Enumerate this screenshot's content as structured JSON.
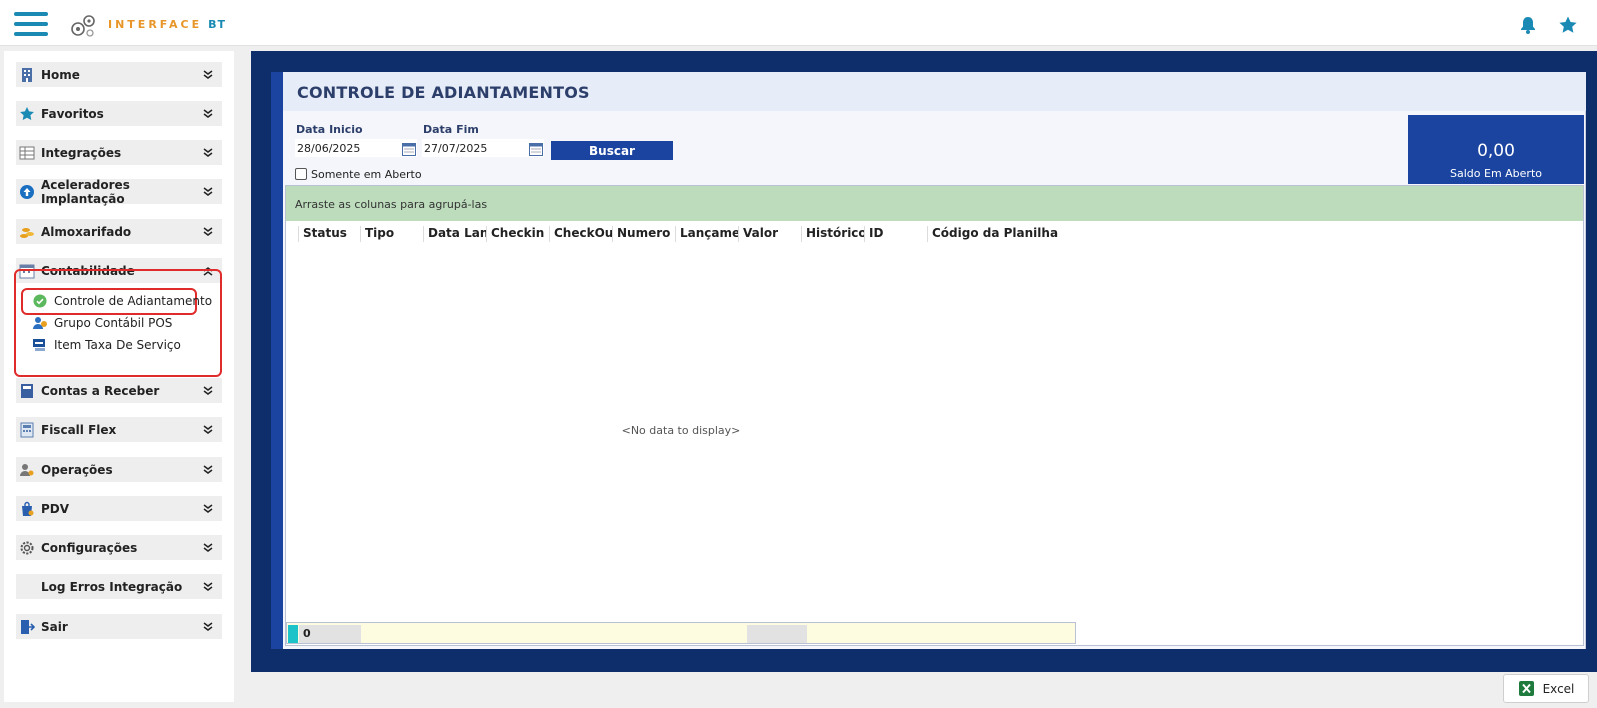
{
  "header": {
    "logo_text": "INTERFACE",
    "logo_suffix": "BT"
  },
  "sidebar": {
    "items": [
      {
        "label": "Home",
        "icon": "building-icon"
      },
      {
        "label": "Favoritos",
        "icon": "star-icon"
      },
      {
        "label": "Integrações",
        "icon": "table-icon"
      },
      {
        "label": "Aceleradores Implantação",
        "icon": "upload-circle-icon"
      },
      {
        "label": "Almoxarifado",
        "icon": "coins-icon"
      },
      {
        "label": "Contabilidade",
        "icon": "calendar-icon",
        "expanded": true
      },
      {
        "label": "Contas a Receber",
        "icon": "book-icon"
      },
      {
        "label": "Fiscall Flex",
        "icon": "calculator-icon"
      },
      {
        "label": "Operações",
        "icon": "user-gear-icon"
      },
      {
        "label": "PDV",
        "icon": "shopping-bag-icon"
      },
      {
        "label": "Configurações",
        "icon": "gear-icon"
      },
      {
        "label": "Log Erros Integração",
        "icon": "log-icon"
      },
      {
        "label": "Sair",
        "icon": "exit-door-icon"
      }
    ],
    "submenu": [
      {
        "label": "Controle de Adiantamento",
        "icon": "check-circle-icon"
      },
      {
        "label": "Grupo Contábil POS",
        "icon": "users-icon"
      },
      {
        "label": "Item Taxa De Serviço",
        "icon": "service-tag-icon"
      }
    ]
  },
  "page": {
    "title": "CONTROLE DE ADIANTAMENTOS"
  },
  "filters": {
    "data_inicio_label": "Data Inicio",
    "data_inicio_value": "28/06/2025",
    "data_fim_label": "Data Fim",
    "data_fim_value": "27/07/2025",
    "buscar_label": "Buscar",
    "somente_aberto_label": "Somente em Aberto"
  },
  "saldo": {
    "value": "0,00",
    "label": "Saldo Em Aberto"
  },
  "grid": {
    "group_hint": "Arraste as colunas para agrupá-las",
    "columns": [
      "Status",
      "Tipo",
      "Data Lançamento",
      "Checkin",
      "CheckOut",
      "Numero Reserva",
      "Lançamentos",
      "Valor",
      "Histórico",
      "ID",
      "Código da Planilha"
    ],
    "empty_text": "<No data to display>",
    "footer_count": "0"
  },
  "actions": {
    "excel_label": "Excel"
  },
  "colors": {
    "accent_blue": "#1b44a0",
    "frame_navy": "#0d2d6b",
    "group_green": "#bcdcbc",
    "highlight_red": "#e02b2b",
    "logo_orange": "#e8962a"
  }
}
